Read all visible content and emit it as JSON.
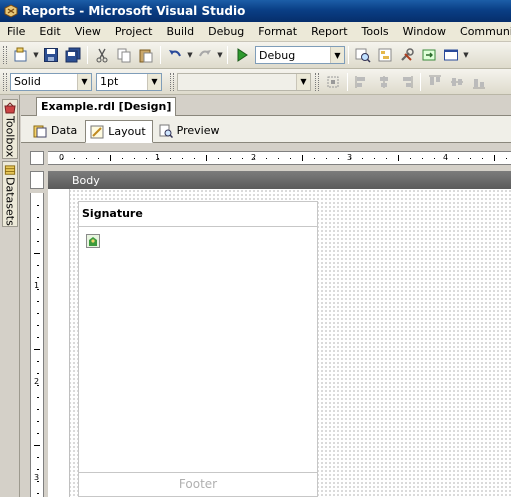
{
  "window": {
    "title": "Reports - Microsoft Visual Studio"
  },
  "menu": {
    "items": [
      "File",
      "Edit",
      "View",
      "Project",
      "Build",
      "Debug",
      "Format",
      "Report",
      "Tools",
      "Window",
      "Community"
    ]
  },
  "toolbar1": {
    "config_value": "Debug"
  },
  "toolbar2": {
    "border_style_value": "Solid",
    "border_width_value": "1pt",
    "font_value": ""
  },
  "side_tabs": {
    "toolbox_label": "Toolbox",
    "datasets_label": "Datasets"
  },
  "document_tab": {
    "label": "Example.rdl [Design]"
  },
  "view_tabs": {
    "data_label": "Data",
    "layout_label": "Layout",
    "preview_label": "Preview",
    "active": "Layout"
  },
  "ruler": {
    "horizontal_numbers": [
      "0",
      "1",
      "2",
      "3",
      "4"
    ],
    "vertical_numbers": [
      "1",
      "2",
      "3"
    ]
  },
  "body_section": {
    "label": "Body"
  },
  "report_item": {
    "header_text": "Signature",
    "footer_text": "Footer"
  },
  "colors": {
    "title_bar": "#0a3f86",
    "canvas_dots": "#7a7a7a",
    "body_bar": "#6b6b6b"
  }
}
